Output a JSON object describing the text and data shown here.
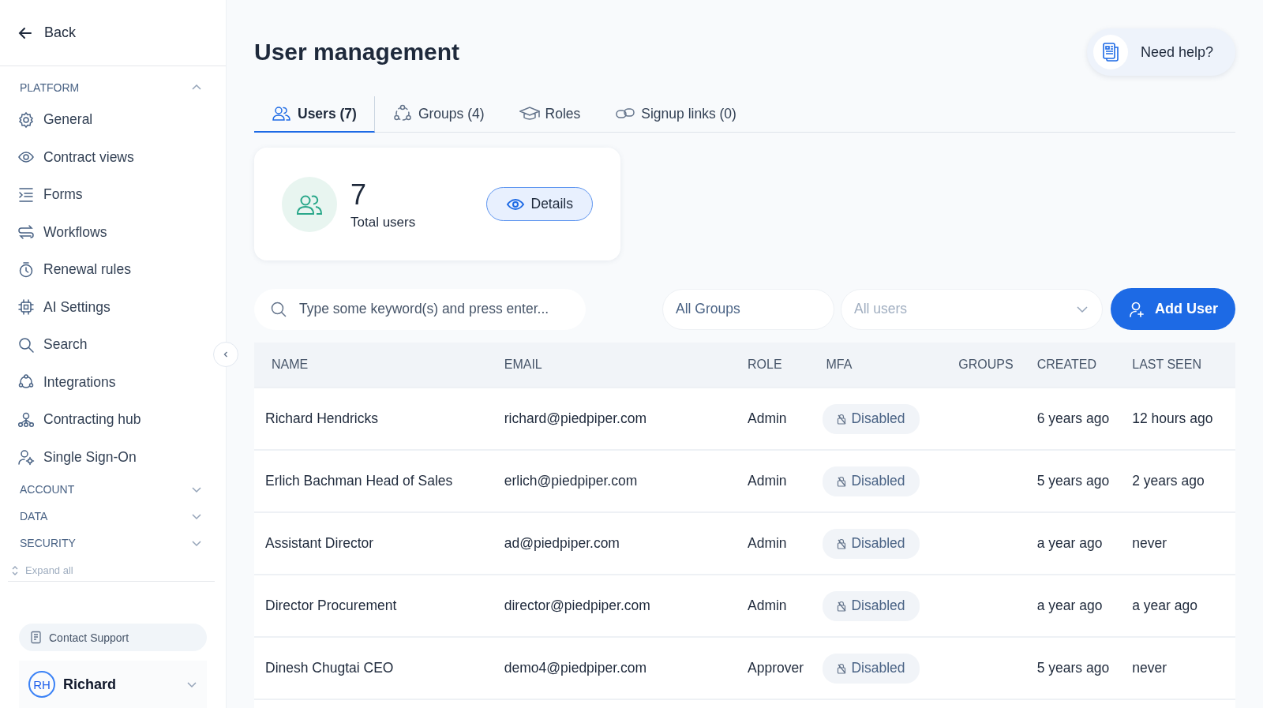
{
  "sidebar": {
    "back": "Back",
    "sections": [
      {
        "title": "PLATFORM",
        "expanded": true,
        "items": [
          {
            "label": "General"
          },
          {
            "label": "Contract views"
          },
          {
            "label": "Forms"
          },
          {
            "label": "Workflows"
          },
          {
            "label": "Renewal rules"
          },
          {
            "label": "AI Settings"
          },
          {
            "label": "Search"
          },
          {
            "label": "Integrations"
          },
          {
            "label": "Contracting hub"
          },
          {
            "label": "Single Sign-On"
          }
        ]
      },
      {
        "title": "ACCOUNT",
        "expanded": false
      },
      {
        "title": "DATA",
        "expanded": false
      },
      {
        "title": "SECURITY",
        "expanded": false
      }
    ],
    "expand_all": "Expand all",
    "contact_support": "Contact Support",
    "user": {
      "initials": "RH",
      "name": "Richard"
    }
  },
  "page": {
    "title": "User management",
    "help": "Need help?"
  },
  "tabs": [
    {
      "label": "Users (7)",
      "selected": true
    },
    {
      "label": "Groups (4)",
      "selected": false
    },
    {
      "label": "Roles",
      "selected": false
    },
    {
      "label": "Signup links (0)",
      "selected": false
    }
  ],
  "summary": {
    "count": "7",
    "label": "Total users",
    "button": "Details"
  },
  "filters": {
    "search_placeholder": "Type some keyword(s) and press enter...",
    "groups_placeholder": "All Groups",
    "users_placeholder": "All users",
    "add_button": "Add User"
  },
  "table": {
    "columns": [
      "NAME",
      "EMAIL",
      "ROLE",
      "MFA",
      "GROUPS",
      "CREATED",
      "LAST SEEN"
    ],
    "rows": [
      {
        "name": "Richard Hendricks",
        "email": "richard@piedpiper.com",
        "role": "Admin",
        "mfa": "Disabled",
        "created": "6 years ago",
        "last_seen": "12 hours ago"
      },
      {
        "name": "Erlich Bachman Head of Sales",
        "email": "erlich@piedpiper.com",
        "role": "Admin",
        "mfa": "Disabled",
        "created": "5 years ago",
        "last_seen": "2 years ago"
      },
      {
        "name": "Assistant Director",
        "email": "ad@piedpiper.com",
        "role": "Admin",
        "mfa": "Disabled",
        "created": "a year ago",
        "last_seen": "never"
      },
      {
        "name": "Director Procurement",
        "email": "director@piedpiper.com",
        "role": "Admin",
        "mfa": "Disabled",
        "created": "a year ago",
        "last_seen": "a year ago"
      },
      {
        "name": "Dinesh Chugtai CEO",
        "email": "demo4@piedpiper.com",
        "role": "Approver",
        "mfa": "Disabled",
        "created": "5 years ago",
        "last_seen": "never"
      }
    ]
  }
}
